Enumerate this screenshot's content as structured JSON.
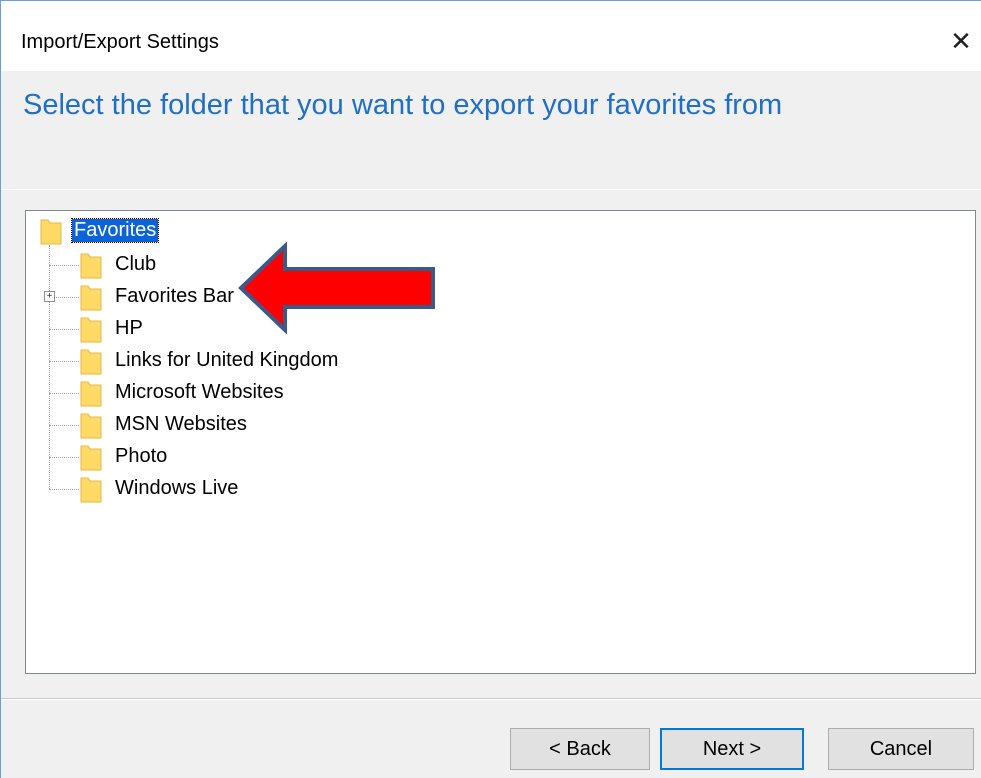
{
  "window": {
    "title": "Import/Export Settings",
    "close_glyph": "✕"
  },
  "header": {
    "instruction": "Select the folder that you want to export your favorites from"
  },
  "tree": {
    "root": {
      "label": "Favorites",
      "icon": "folder-icon",
      "selected": true
    },
    "children": [
      {
        "label": "Club",
        "icon": "folder-icon",
        "expandable": false
      },
      {
        "label": "Favorites Bar",
        "icon": "folder-icon",
        "expandable": true,
        "expander_glyph": "+"
      },
      {
        "label": "HP",
        "icon": "folder-icon",
        "expandable": false
      },
      {
        "label": "Links for United Kingdom",
        "icon": "folder-icon",
        "expandable": false
      },
      {
        "label": "Microsoft Websites",
        "icon": "folder-icon",
        "expandable": false
      },
      {
        "label": "MSN Websites",
        "icon": "folder-icon",
        "expandable": false
      },
      {
        "label": "Photo",
        "icon": "folder-icon",
        "expandable": false
      },
      {
        "label": "Windows Live",
        "icon": "folder-icon",
        "expandable": false
      }
    ]
  },
  "annotation": {
    "icon": "red-arrow-icon",
    "color": "#ff0000",
    "outline": "#3b5a8a"
  },
  "buttons": {
    "back": "< Back",
    "next": "Next >",
    "cancel": "Cancel"
  },
  "colors": {
    "header_text": "#1f6fc4",
    "selection": "#0a64d8",
    "folder": "#ffd966"
  }
}
